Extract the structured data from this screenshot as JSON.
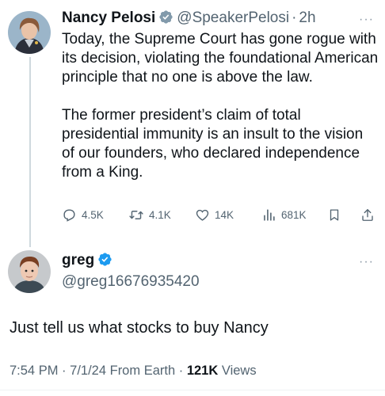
{
  "tweet": {
    "author_name": "Nancy Pelosi",
    "handle": "@SpeakerPelosi",
    "separator": "·",
    "time": "2h",
    "more": "···",
    "paragraph1": "Today, the Supreme Court has gone rogue with its decision, violating the foundational American principle that no one is above the law.",
    "paragraph2": "The former president’s claim of total presidential immunity is an insult to the vision of our founders, who declared independence from a King.",
    "verified_badge": "gray-check",
    "actions": {
      "replies": "4.5K",
      "reposts": "4.1K",
      "likes": "14K",
      "views": "681K"
    }
  },
  "reply": {
    "author_name": "greg",
    "handle": "@greg16676935420",
    "more": "···",
    "verified_badge": "blue-check",
    "text": "Just tell us what stocks to buy Nancy",
    "time": "7:54 PM",
    "dot": "·",
    "date": "7/1/24",
    "source": "From Earth",
    "views_count": "121K",
    "views_label": "Views"
  },
  "colors": {
    "text": "#0f1419",
    "secondary": "#536471",
    "verified_blue": "#1d9bf0",
    "verified_gray": "#829aab",
    "thread_line": "#cfd9de"
  }
}
